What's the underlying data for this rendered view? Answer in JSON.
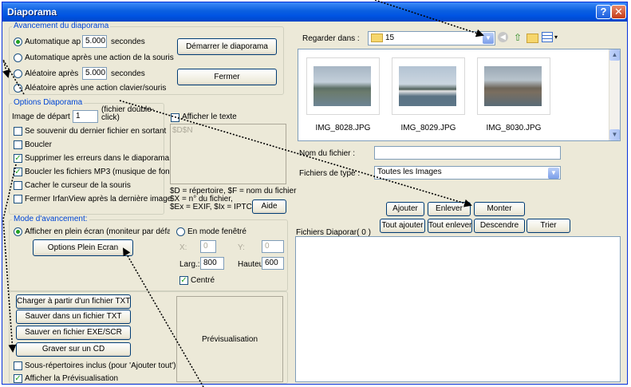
{
  "window": {
    "title": "Diaporama",
    "help_label": "?",
    "close_label": "✕"
  },
  "advancement": {
    "legend": "Avancement du diaporama",
    "auto_label": "Automatique ap",
    "auto_value": "5.000",
    "auto_unit": "secondes",
    "mouse_label": "Automatique après une action de la souris",
    "random_label": "Aléatoire après",
    "random_value": "5.000",
    "random_unit": "secondes",
    "random_key_label": "Aléatoire après une action clavier/souris",
    "start_button": "Démarrer le diaporama",
    "close_button": "Fermer"
  },
  "options": {
    "legend": "Options Diaporama",
    "start_image_label": "Image de départ n°:",
    "start_image_value": "1",
    "start_image_hint": "(fichier double-click)",
    "remember_last": "Se souvenir du dernier fichier en sortant",
    "loop": "Boucler",
    "suppress_errors": "Supprimer les erreurs dans le diaporama",
    "loop_mp3": "Boucler les fichiers MP3 (musique de fond)",
    "hide_cursor": "Cacher le curseur de la souris",
    "close_after": "Fermer IrfanView après la dernière image",
    "show_text": "Afficher le texte",
    "text_placeholder": "$D$N",
    "help_text_1": "$D = répertoire, $F = nom du fichier",
    "help_text_2": "$X = n° du fichier,",
    "help_text_3": "$Ex = EXIF, $Ix = IPTC ...",
    "help_button": "Aide"
  },
  "mode": {
    "legend": "Mode d'avancement:",
    "fullscreen_label": "Afficher en plein écran (moniteur par défaul",
    "window_label": "En mode fenêtré",
    "fullscreen_options_button": "Options Plein Ecran",
    "x_label": "X:",
    "x_value": "0",
    "y_label": "Y:",
    "y_value": "0",
    "width_label": "Larg.:",
    "width_value": "800",
    "height_label": "Hauteu",
    "height_value": "600",
    "centered_label": "Centré"
  },
  "file_actions": {
    "load_txt": "Charger à partir d'un fichier TXT",
    "save_txt": "Sauver dans un fichier TXT",
    "save_exe": "Sauver en fichier EXE/SCR",
    "burn_cd": "Graver sur un CD",
    "subdirs": "Sous-répertoires inclus (pour 'Ajouter tout')",
    "show_preview": "Afficher la Prévisualisation",
    "preview_label": "Prévisualisation"
  },
  "browser": {
    "look_in_label": "Regarder dans :",
    "folder": "15",
    "files": [
      {
        "name": "IMG_8028.JPG"
      },
      {
        "name": "IMG_8029.JPG"
      },
      {
        "name": "IMG_8030.JPG"
      }
    ],
    "filename_label": "Nom du fichier :",
    "filename_value": "",
    "filetype_label": "Fichiers de type :",
    "filetype_value": "Toutes les Images"
  },
  "list_actions": {
    "add": "Ajouter",
    "remove": "Enlever",
    "up": "Monter",
    "add_all": "Tout ajouter",
    "remove_all": "Tout enlever",
    "down": "Descendre",
    "sort": "Trier",
    "list_label": "Fichiers Diaporar( 0 )"
  },
  "colors": {
    "title_bar": "#0054e3",
    "group_label": "#0046d5",
    "window_bg": "#ece9d8",
    "check_green": "#21a121"
  }
}
